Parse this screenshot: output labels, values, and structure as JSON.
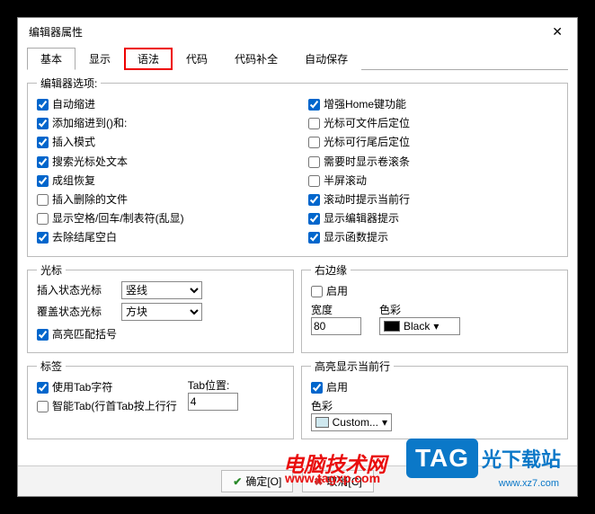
{
  "title": "编辑器属性",
  "tabs": [
    "基本",
    "显示",
    "语法",
    "代码",
    "代码补全",
    "自动保存"
  ],
  "activeTab": 0,
  "highlightTab": 2,
  "editorOptions": {
    "legend": "编辑器选项:",
    "left": [
      {
        "label": "自动缩进",
        "checked": true
      },
      {
        "label": "添加缩进到()和:",
        "checked": true
      },
      {
        "label": "插入模式",
        "checked": true
      },
      {
        "label": "搜索光标处文本",
        "checked": true
      },
      {
        "label": "成组恢复",
        "checked": true
      },
      {
        "label": "插入删除的文件",
        "checked": false
      },
      {
        "label": "显示空格/回车/制表符(乱显)",
        "checked": false
      },
      {
        "label": "去除结尾空白",
        "checked": true
      }
    ],
    "right": [
      {
        "label": "增强Home键功能",
        "checked": true
      },
      {
        "label": "光标可文件后定位",
        "checked": false
      },
      {
        "label": "光标可行尾后定位",
        "checked": false
      },
      {
        "label": "需要时显示卷滚条",
        "checked": false
      },
      {
        "label": "半屏滚动",
        "checked": false
      },
      {
        "label": "滚动时提示当前行",
        "checked": true
      },
      {
        "label": "显示编辑器提示",
        "checked": true
      },
      {
        "label": "显示函数提示",
        "checked": true
      }
    ]
  },
  "cursor": {
    "legend": "光标",
    "insertLabel": "插入状态光标",
    "insertValue": "竖线",
    "overLabel": "覆盖状态光标",
    "overValue": "方块",
    "highlightBracket": {
      "label": "高亮匹配括号",
      "checked": true
    }
  },
  "rightEdge": {
    "legend": "右边缘",
    "enable": {
      "label": "启用",
      "checked": false
    },
    "widthLabel": "宽度",
    "widthValue": "80",
    "colorLabel": "色彩",
    "colorValue": "Black",
    "colorSwatch": "#000000"
  },
  "tabSection": {
    "legend": "标签",
    "useTab": {
      "label": "使用Tab字符",
      "checked": true
    },
    "smartTab": {
      "label": "智能Tab(行首Tab按上行行",
      "checked": false
    },
    "posLabel": "Tab位置:",
    "posValue": "4"
  },
  "highlightLine": {
    "legend": "高亮显示当前行",
    "enable": {
      "label": "启用",
      "checked": true
    },
    "colorLabel": "色彩",
    "colorValue": "Custom...",
    "colorSwatch": "#cfe8ef"
  },
  "footer": {
    "ok": "确定[O]",
    "cancel": "取消[C]"
  },
  "watermarks": {
    "w1a": "电脑技术网",
    "w1b": "www.tagxp.com",
    "tag": "TAG",
    "w2a": "光下载站",
    "w2b": "www.xz7.com"
  }
}
